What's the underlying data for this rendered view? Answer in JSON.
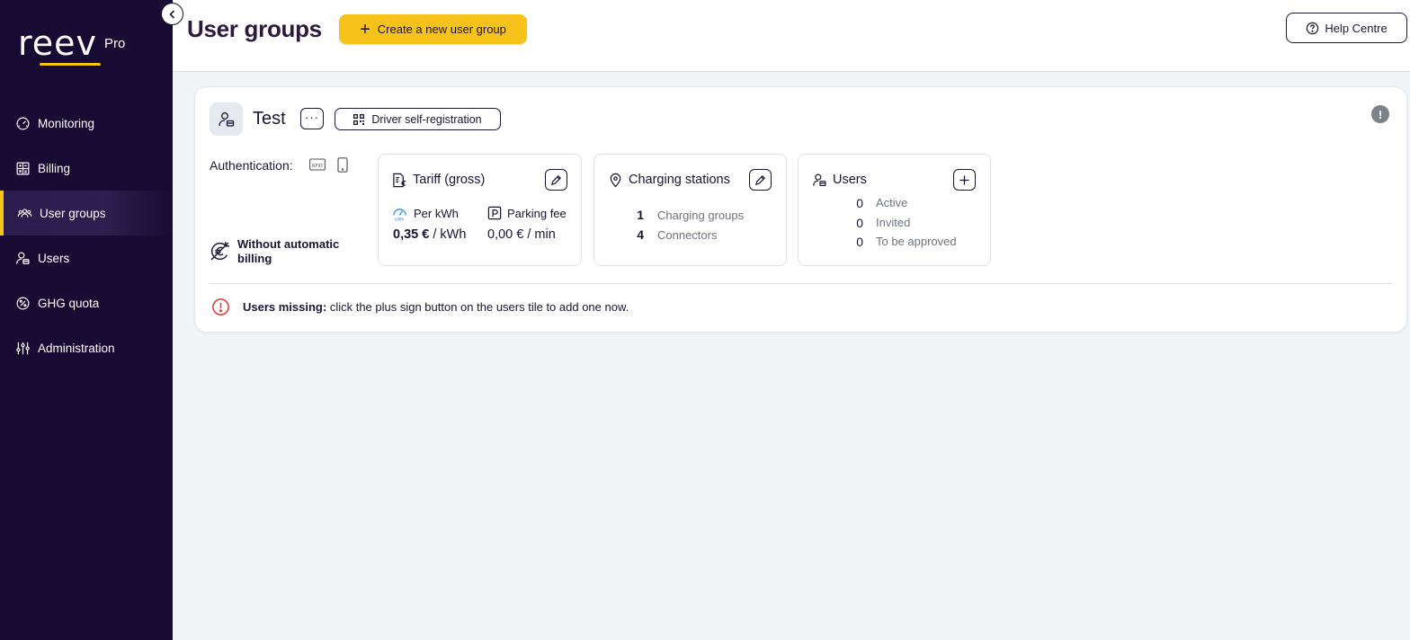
{
  "brand": {
    "wordmark": "reev",
    "tier": "Pro",
    "accent": "#f5c518",
    "sidebar_bg": "#180b33"
  },
  "sidebar": {
    "items": [
      {
        "label": "Monitoring",
        "icon": "gauge-icon"
      },
      {
        "label": "Billing",
        "icon": "calculator-icon"
      },
      {
        "label": "User groups",
        "icon": "user-group-icon",
        "active": true
      },
      {
        "label": "Users",
        "icon": "user-icon"
      },
      {
        "label": "GHG quota",
        "icon": "percent-icon"
      },
      {
        "label": "Administration",
        "icon": "sliders-icon"
      }
    ]
  },
  "header": {
    "title": "User groups",
    "create_label": "Create a new user group",
    "help_label": "Help Centre"
  },
  "group": {
    "name": "Test",
    "more_label": "···",
    "selfreg_label": "Driver self-registration",
    "info_label": "!",
    "auth_label": "Authentication:",
    "billing_label": "Without automatic billing",
    "tariff": {
      "title": "Tariff (gross)",
      "per_kwh_label": "Per kWh",
      "per_kwh_value": "0,35 €",
      "per_kwh_unit": " / kWh",
      "parking_label": "Parking fee",
      "parking_value": "0,00 € / min"
    },
    "stations": {
      "title": "Charging stations",
      "rows": [
        {
          "count": "1",
          "label": "Charging groups"
        },
        {
          "count": "4",
          "label": "Connectors"
        }
      ]
    },
    "users": {
      "title": "Users",
      "rows": [
        {
          "count": "0",
          "label": "Active"
        },
        {
          "count": "0",
          "label": "Invited"
        },
        {
          "count": "0",
          "label": "To be approved"
        }
      ]
    },
    "warning": {
      "bold": "Users missing:",
      "text": " click the plus sign button on the users tile to add one now.",
      "color": "#e53935"
    }
  }
}
